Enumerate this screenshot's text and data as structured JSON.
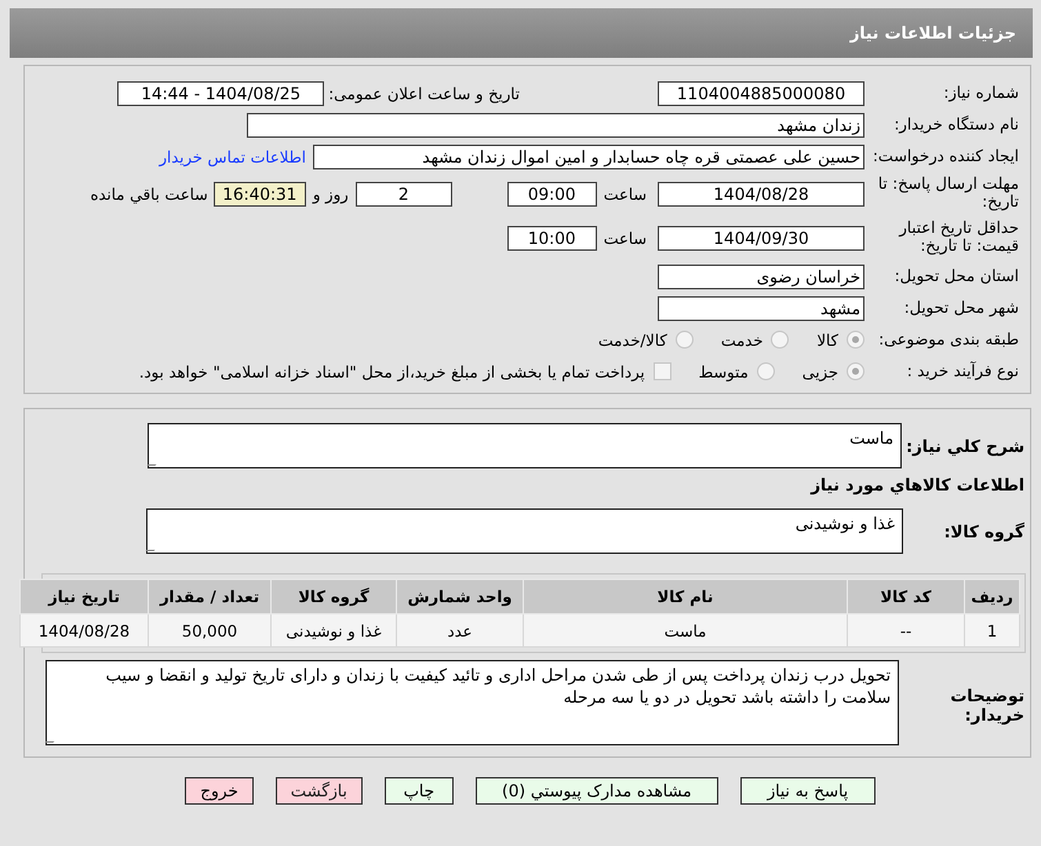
{
  "header": {
    "title": "جزئیات اطلاعات نیاز"
  },
  "need_number": {
    "label": "شماره نیاز:",
    "value": "1104004885000080"
  },
  "announce": {
    "label": "تاريخ و ساعت اعلان عمومی:",
    "value": "1404/08/25 - 14:44"
  },
  "buyer_org": {
    "label": "نام دستگاه خریدار:",
    "value": "زندان مشهد"
  },
  "requester": {
    "label": "ایجاد کننده درخواست:",
    "value": "حسین علی عصمتی قره چاه حسابدار و امین اموال زندان مشهد",
    "link": "اطلاعات تماس خریدار"
  },
  "deadline": {
    "label": "مهلت ارسال پاسخ: تا تاریخ:",
    "date": "1404/08/28",
    "time_label": "ساعت",
    "time": "09:00",
    "days": "2",
    "days_label": "روز و",
    "remaining": "16:40:31",
    "remaining_label": "ساعت باقي مانده"
  },
  "validity": {
    "label": "حداقل تاریخ اعتبار قیمت: تا تاریخ:",
    "date": "1404/09/30",
    "time_label": "ساعت",
    "time": "10:00"
  },
  "province": {
    "label": "استان محل تحویل:",
    "value": "خراسان رضوی"
  },
  "city": {
    "label": "شهر محل تحویل:",
    "value": "مشهد"
  },
  "category": {
    "label": "طبقه بندی موضوعی:",
    "options": [
      {
        "label": "کالا",
        "selected": true
      },
      {
        "label": "خدمت",
        "selected": false
      },
      {
        "label": "کالا/خدمت",
        "selected": false
      }
    ]
  },
  "process": {
    "label": "نوع فرآیند خرید :",
    "options": [
      {
        "label": "جزیی",
        "selected": true
      },
      {
        "label": "متوسط",
        "selected": false
      }
    ],
    "treasury": {
      "checked": false,
      "text": "پرداخت تمام یا بخشی از مبلغ خرید،از محل \"اسناد خزانه اسلامی\" خواهد بود."
    }
  },
  "description": {
    "label": "شرح کلي نياز:",
    "value": "ماست"
  },
  "goods_title": "اطلاعات کالاهاي مورد نياز",
  "goods_group": {
    "label": "گروه کالا:",
    "value": "غذا و نوشیدنی"
  },
  "table": {
    "columns": [
      "ردیف",
      "کد کالا",
      "نام کالا",
      "واحد شمارش",
      "گروه کالا",
      "تعداد / مقدار",
      "تاریخ نیاز"
    ],
    "rows": [
      [
        "1",
        "--",
        "ماست",
        "عدد",
        "غذا و نوشیدنی",
        "50,000",
        "1404/08/28"
      ]
    ]
  },
  "notes": {
    "label": "توضیحات خریدار:",
    "value": "تحویل درب زندان پرداخت پس از طی شدن مراحل اداری و تائید کیفیت با زندان و دارای تاریخ تولید و انقضا و سیب سلامت را داشته باشد تحویل در دو یا سه مرحله"
  },
  "buttons": [
    {
      "label": "پاسخ به نیاز",
      "kind": "normal"
    },
    {
      "label": "مشاهده مدارک پیوستي (0)",
      "kind": "normal"
    },
    {
      "label": "چاپ",
      "kind": "normal"
    },
    {
      "label": "بازگشت",
      "kind": "back"
    },
    {
      "label": "خروج",
      "kind": "exit"
    }
  ]
}
